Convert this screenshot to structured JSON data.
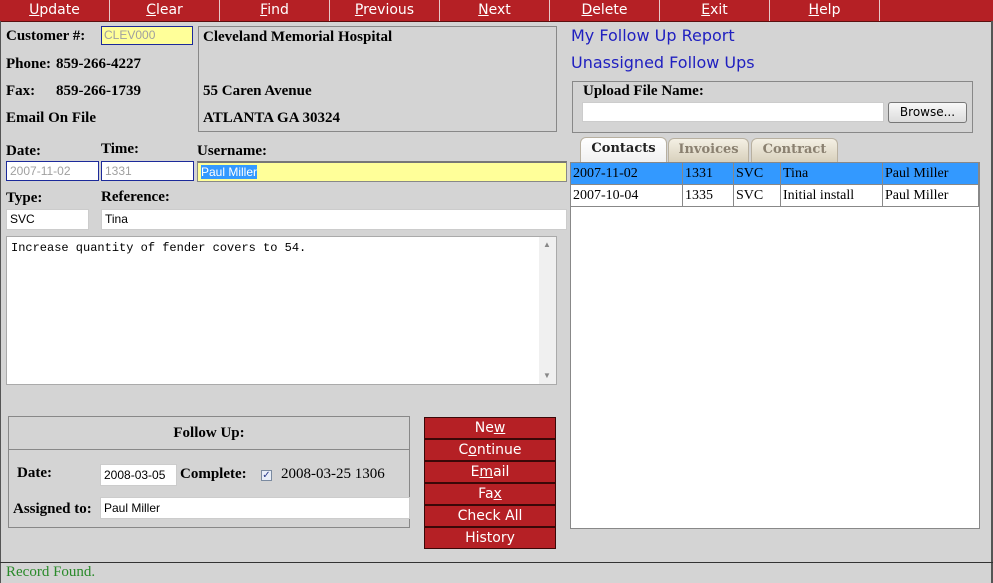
{
  "menu": [
    {
      "label": "Update",
      "accel": "U"
    },
    {
      "label": "Clear",
      "accel": "C"
    },
    {
      "label": "Find",
      "accel": "F"
    },
    {
      "label": "Previous",
      "accel": "P"
    },
    {
      "label": "Next",
      "accel": "N"
    },
    {
      "label": "Delete",
      "accel": "D"
    },
    {
      "label": "Exit",
      "accel": "E"
    },
    {
      "label": "Help",
      "accel": "H"
    }
  ],
  "customer": {
    "number_label": "Customer #:",
    "number_value": "CLEV000",
    "phone_label": "Phone:",
    "phone_value": "859-266-4227",
    "fax_label": "Fax:",
    "fax_value": "859-266-1739",
    "email_text": "Email On File",
    "name": "Cleveland Memorial Hospital",
    "address1": "55 Caren Avenue",
    "address2": "ATLANTA GA 30324"
  },
  "links": {
    "follow_up_report": "My Follow Up Report",
    "unassigned": "Unassigned Follow Ups"
  },
  "upload": {
    "label": "Upload File Name:",
    "value": "",
    "browse_label": "Browse..."
  },
  "contact": {
    "date_label": "Date:",
    "date_value": "2007-11-02",
    "time_label": "Time:",
    "time_value": "1331",
    "username_label": "Username:",
    "username_value": "Paul Miller",
    "type_label": "Type:",
    "type_value": "SVC",
    "reference_label": "Reference:",
    "reference_value": "Tina",
    "notes": "Increase quantity of fender covers to 54."
  },
  "tabs": [
    {
      "label": "Contacts",
      "active": true
    },
    {
      "label": "Invoices",
      "active": false
    },
    {
      "label": "Contract",
      "active": false
    }
  ],
  "contacts_table": {
    "rows": [
      {
        "date": "2007-11-02",
        "time": "1331",
        "type": "SVC",
        "reference": "Tina",
        "user": "Paul Miller",
        "selected": true
      },
      {
        "date": "2007-10-04",
        "time": "1335",
        "type": "SVC",
        "reference": "Initial install",
        "user": "Paul Miller",
        "selected": false
      }
    ]
  },
  "followup": {
    "title": "Follow Up:",
    "date_label": "Date:",
    "date_value": "2008-03-05",
    "complete_label": "Complete:",
    "complete_checked": true,
    "complete_value": "2008-03-25 1306",
    "assigned_label": "Assigned to:",
    "assigned_value": "Paul Miller"
  },
  "action_buttons": [
    {
      "label": "New",
      "accel_index": 2
    },
    {
      "label": "Continue",
      "accel_index": 1
    },
    {
      "label": "Email",
      "accel_index": 1
    },
    {
      "label": "Fax",
      "accel_index": 2
    },
    {
      "label": "Check All",
      "accel_index": -1
    },
    {
      "label": "History",
      "accel_index": -1
    }
  ],
  "status": {
    "text": "Record Found.",
    "color": "#2a8a2a"
  },
  "colors": {
    "brand_red": "#b52025",
    "selection_blue": "#3399ff",
    "highlight_yellow": "#ffff99",
    "link_blue": "#2020c0"
  }
}
